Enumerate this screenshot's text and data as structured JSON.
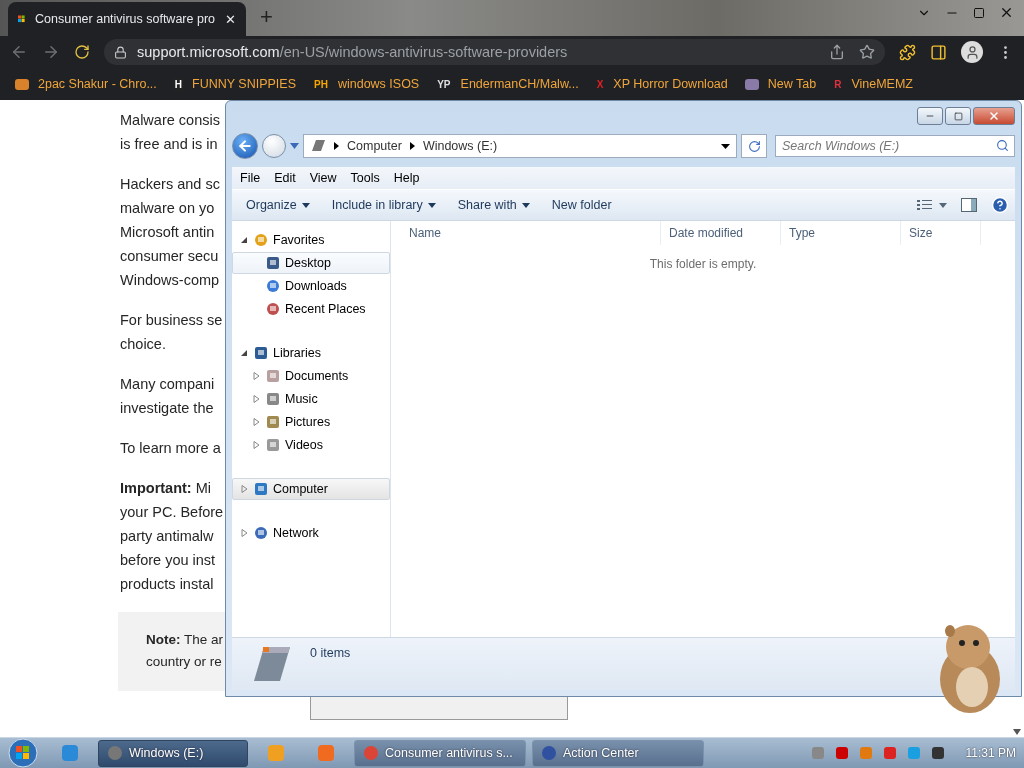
{
  "browser": {
    "tab": {
      "title": "Consumer antivirus software pro",
      "close": "✕"
    },
    "new_tab": "+",
    "url": {
      "host": "support.microsoft.com",
      "path": "/en-US/windows-antivirus-software-providers"
    },
    "bookmarks": [
      {
        "label": "2pac Shakur - Chro...",
        "kind": "image",
        "color": "#d9822b"
      },
      {
        "label": "FUNNY SNIPPIES",
        "kind": "glyph",
        "glyph": "H",
        "color": "#ffffff"
      },
      {
        "label": "windows ISOS",
        "kind": "glyph",
        "glyph": "PH",
        "color": "#f7a600"
      },
      {
        "label": "EndermanCH/Malw...",
        "kind": "glyph",
        "glyph": "YP",
        "color": "#e0e0e0"
      },
      {
        "label": "XP Horror Download",
        "kind": "glyph",
        "glyph": "X",
        "color": "#e02020"
      },
      {
        "label": "New Tab",
        "kind": "image",
        "color": "#8a7aa8"
      },
      {
        "label": "VineMEMZ",
        "kind": "glyph",
        "glyph": "R",
        "color": "#e0303e"
      }
    ]
  },
  "page": {
    "paragraphs": [
      {
        "lines": [
          "Malware consis",
          "is free and is in"
        ]
      },
      {
        "lines": [
          "Hackers and sc",
          "malware on yo",
          "Microsoft antin",
          "consumer secu",
          "Windows-comp"
        ]
      },
      {
        "lines": [
          "For business se",
          "choice."
        ]
      },
      {
        "lines": [
          "Many compani",
          "investigate the"
        ]
      },
      {
        "lines": [
          "To learn more a"
        ]
      },
      {
        "lines": [
          "**Important:** Mi",
          "your PC. Before",
          "party antimalw",
          "before you inst",
          "products instal"
        ]
      }
    ],
    "note": {
      "lines": [
        "**Note:** The ar",
        "country or re"
      ]
    }
  },
  "explorer": {
    "breadcrumb": [
      "Computer",
      "Windows (E:)"
    ],
    "search": {
      "placeholder": "Search Windows (E:)"
    },
    "menu": [
      "File",
      "Edit",
      "View",
      "Tools",
      "Help"
    ],
    "commands": [
      {
        "label": "Organize",
        "dropdown": true
      },
      {
        "label": "Include in library",
        "dropdown": true
      },
      {
        "label": "Share with",
        "dropdown": true
      },
      {
        "label": "New folder",
        "dropdown": false
      }
    ],
    "nav": [
      {
        "label": "Favorites",
        "kind": "folder",
        "expanded": true,
        "selected": false,
        "hovered": false,
        "children": [
          {
            "label": "Desktop",
            "kind": "link",
            "selected": false,
            "hovered": true
          },
          {
            "label": "Downloads",
            "kind": "link",
            "selected": false,
            "hovered": false
          },
          {
            "label": "Recent Places",
            "kind": "link",
            "selected": false,
            "hovered": false
          }
        ]
      },
      {
        "label": "Libraries",
        "kind": "folder",
        "expanded": true,
        "selected": false,
        "hovered": false,
        "children": [
          {
            "label": "Documents",
            "kind": "folder",
            "expanded": false,
            "selected": false,
            "hovered": false
          },
          {
            "label": "Music",
            "kind": "folder",
            "expanded": false,
            "selected": false,
            "hovered": false
          },
          {
            "label": "Pictures",
            "kind": "folder",
            "expanded": false,
            "selected": false,
            "hovered": false
          },
          {
            "label": "Videos",
            "kind": "folder",
            "expanded": false,
            "selected": false,
            "hovered": false
          }
        ]
      },
      {
        "label": "Computer",
        "kind": "folder",
        "expanded": false,
        "selected": true,
        "hovered": false
      },
      {
        "label": "Network",
        "kind": "folder",
        "expanded": false,
        "selected": false,
        "hovered": false
      }
    ],
    "columns": [
      "Name",
      "Date modified",
      "Type",
      "Size"
    ],
    "empty_message": "This folder is empty.",
    "status": "0 items"
  },
  "taskbar": {
    "items": [
      {
        "kind": "pinned",
        "color": "#2a8ad8"
      },
      {
        "kind": "window",
        "label": "Windows (E:)",
        "color": "#777777",
        "active": true
      },
      {
        "kind": "pinned",
        "color": "#f0a020"
      },
      {
        "kind": "pinned",
        "color": "#f06a20"
      },
      {
        "kind": "window",
        "label": "Consumer antivirus s...",
        "color": "#db4437",
        "active": false
      },
      {
        "kind": "window",
        "label": "Action Center",
        "color": "#3050a0",
        "active": false
      }
    ],
    "clock": "11:31 PM"
  }
}
